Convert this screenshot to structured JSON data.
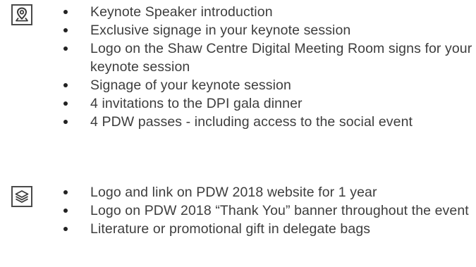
{
  "sections": [
    {
      "icon": "location-pin-icon",
      "items": [
        "Keynote Speaker introduction",
        "Exclusive signage in your keynote session",
        "Logo on the Shaw Centre Digital Meeting Room signs for your keynote session",
        "Signage of your keynote session",
        "4 invitations to the DPI gala dinner",
        "4 PDW passes - including access to the social event"
      ]
    },
    {
      "icon": "layers-icon",
      "items": [
        "Logo and  link on PDW 2018  website for 1 year",
        "Logo on PDW 2018 “Thank You” banner throughout the event",
        "Literature or promotional gift in delegate bags"
      ]
    }
  ],
  "colors": {
    "text": "#3d3d3d",
    "bullet": "#222222",
    "icon_border": "#4a4a4a"
  }
}
